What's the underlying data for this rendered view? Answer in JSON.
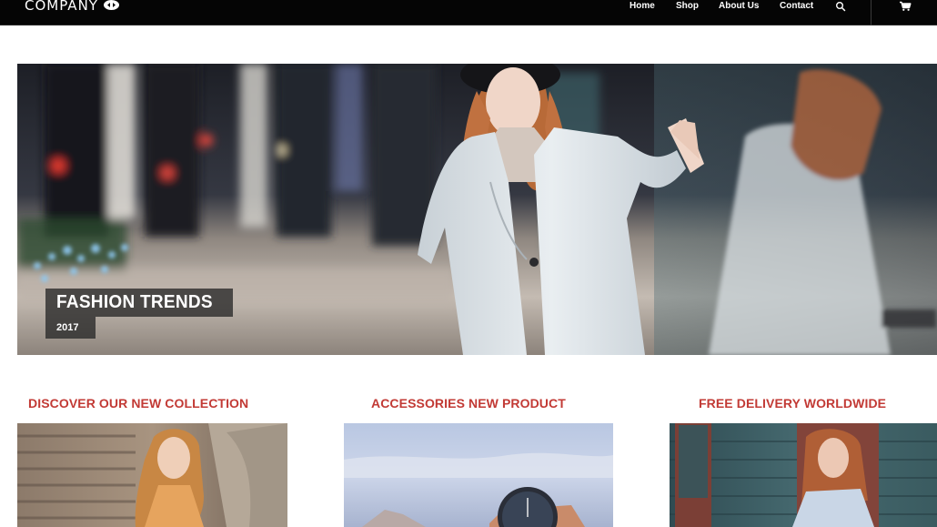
{
  "header": {
    "logo_text": "COMPANY",
    "nav": {
      "home": "Home",
      "shop": "Shop",
      "about": "About Us",
      "contact": "Contact"
    },
    "icons": {
      "search": "search-icon",
      "cart": "cart-icon"
    }
  },
  "hero": {
    "title": "FASHION TRENDS",
    "year": "2017"
  },
  "features": [
    {
      "heading": "DISCOVER OUR NEW COLLECTION"
    },
    {
      "heading": "ACCESSORIES NEW PRODUCT"
    },
    {
      "heading": "FREE DELIVERY WORLDWIDE"
    }
  ],
  "colors": {
    "topbar": "#050505",
    "heading_accent": "#c23a35",
    "caption_box": "#282828"
  }
}
